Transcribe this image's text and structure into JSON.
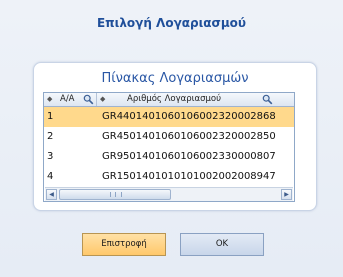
{
  "dialog": {
    "title": "Επιλογή Λογαριασμού"
  },
  "table": {
    "title": "Πίνακας Λογαριασμών",
    "columns": {
      "aa": "Α/Α",
      "account": "Αριθμός Λογαριασμού"
    },
    "rows": [
      {
        "aa": "1",
        "account": "GR4401401060106002320002868",
        "selected": true
      },
      {
        "aa": "2",
        "account": "GR4501401060106002320002850",
        "selected": false
      },
      {
        "aa": "3",
        "account": "GR9501401060106002330000807",
        "selected": false
      },
      {
        "aa": "4",
        "account": "GR1501401010101002002008947",
        "selected": false
      }
    ]
  },
  "buttons": {
    "back_label": "Επιστροφή",
    "ok_label": "OK"
  },
  "icons": {
    "sort": "sort-icon",
    "search": "search-icon",
    "scroll_left": "arrow-left-icon",
    "scroll_right": "arrow-right-icon"
  },
  "colors": {
    "title_blue": "#1f4f9a",
    "selected_row": "#ffd98c",
    "back_button": "#ffc86b"
  }
}
